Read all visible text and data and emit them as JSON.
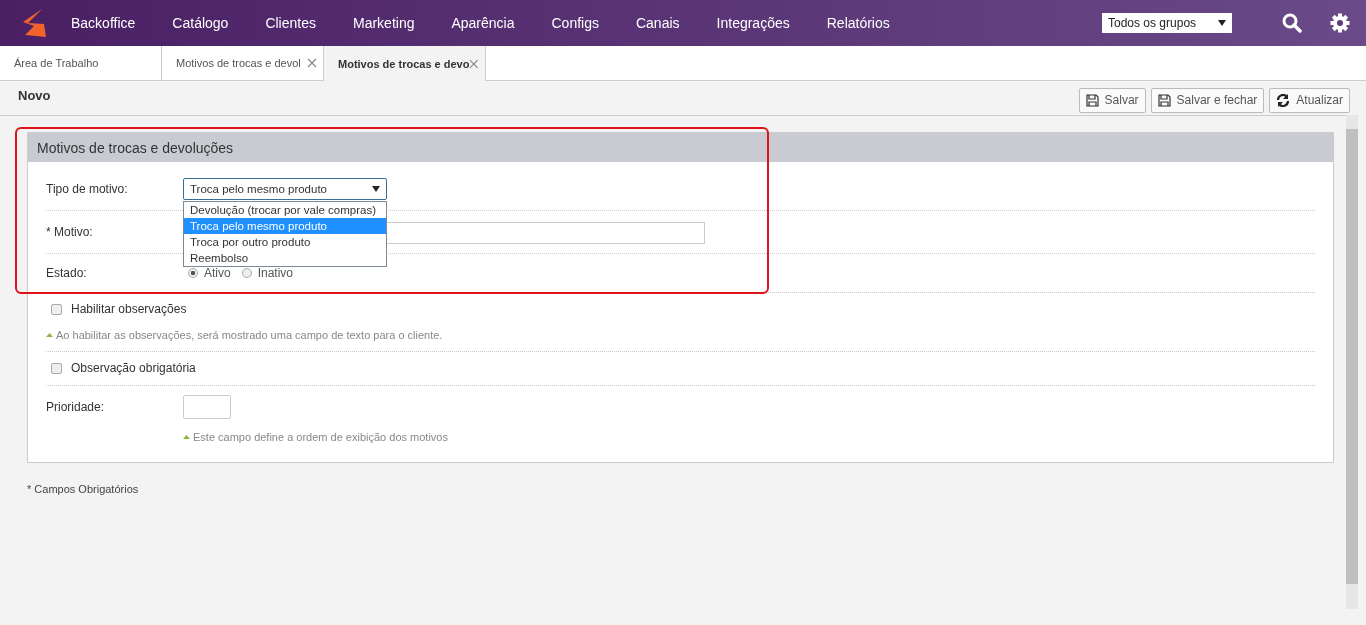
{
  "nav": {
    "items": [
      "Backoffice",
      "Catálogo",
      "Clientes",
      "Marketing",
      "Aparência",
      "Configs",
      "Canais",
      "Integrações",
      "Relatórios"
    ],
    "group_select": "Todos os grupos"
  },
  "tabs": [
    {
      "label": "Área de Trabalho",
      "selected": false,
      "closable": false
    },
    {
      "label": "Motivos de trocas e devol",
      "selected": false,
      "closable": true
    },
    {
      "label": "Motivos de trocas e devo",
      "selected": true,
      "closable": true
    }
  ],
  "page_title": "Novo",
  "buttons": [
    {
      "label": "Salvar",
      "kind": "save"
    },
    {
      "label": "Salvar e fechar",
      "kind": "save"
    },
    {
      "label": "Atualizar",
      "kind": "refresh"
    }
  ],
  "panel": {
    "title": "Motivos de trocas e devoluções",
    "tipo": {
      "label": "Tipo de motivo:",
      "value": "Troca pelo mesmo produto",
      "expanded": true,
      "options": [
        {
          "label": "Devolução (trocar por vale compras)",
          "selected": false
        },
        {
          "label": "Troca pelo mesmo produto",
          "selected": true
        },
        {
          "label": "Troca por outro produto",
          "selected": false
        },
        {
          "label": "Reembolso",
          "selected": false
        }
      ]
    },
    "motivo": {
      "label": "* Motivo:"
    },
    "estado": {
      "label": "Estado:",
      "options": [
        {
          "label": "Ativo",
          "selected": true
        },
        {
          "label": "Inativo",
          "selected": false
        }
      ]
    },
    "checks": [
      {
        "label": "Habilitar observações",
        "checked": false,
        "hint": "Ao habilitar as observações, será mostrado uma campo de texto para o cliente."
      },
      {
        "label": "Observação obrigatória",
        "checked": false
      }
    ],
    "prioridade": {
      "label": "Prioridade:",
      "hint": "Este campo define a ordem de exibição dos motivos"
    }
  },
  "footnote": "* Campos Obrigatórios"
}
